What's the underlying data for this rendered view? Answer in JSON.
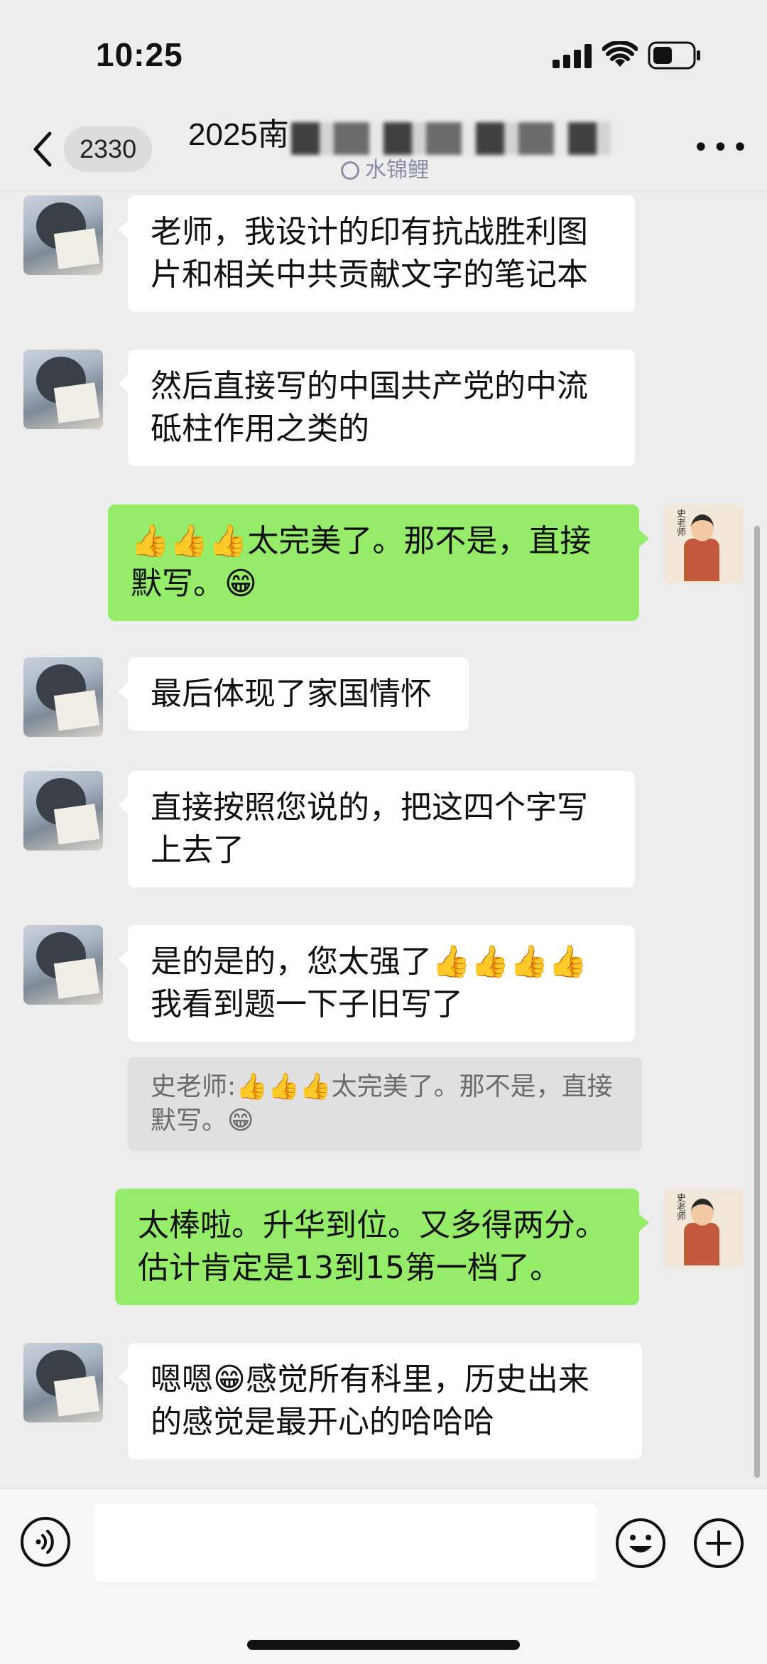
{
  "status_bar": {
    "time": "10:25"
  },
  "nav": {
    "back_count": "2330",
    "title": "2025南",
    "subtitle": "水锦鲤",
    "more_icon": "more-dots-icon"
  },
  "messages": [
    {
      "side": "left",
      "sender": "student",
      "text": "老师，我设计的印有抗战胜利图片和相关中共贡献文字的笔记本"
    },
    {
      "side": "left",
      "sender": "student",
      "text": "然后直接写的中国共产党的中流砥柱作用之类的"
    },
    {
      "side": "right",
      "sender": "teacher",
      "text": "👍👍👍太完美了。那不是，直接默写。😁"
    },
    {
      "side": "left",
      "sender": "student",
      "text": "最后体现了家国情怀"
    },
    {
      "side": "left",
      "sender": "student",
      "text": "直接按照您说的，把这四个字写上去了"
    },
    {
      "side": "left",
      "sender": "student",
      "text": "是的是的，您太强了👍👍👍👍我看到题一下子旧写了",
      "quote": "史老师:👍👍👍太完美了。那不是，直接默写。😁"
    },
    {
      "side": "right",
      "sender": "teacher",
      "text": "太棒啦。升华到位。又多得两分。估计肯定是13到15第一档了。"
    },
    {
      "side": "left",
      "sender": "student",
      "text": "嗯嗯😁感觉所有科里，历史出来的感觉是最开心的哈哈哈"
    }
  ],
  "teacher_avatar_label": "史老师",
  "input_bar": {
    "voice_icon": "voice-icon",
    "emoji_icon": "emoji-icon",
    "plus_icon": "plus-icon"
  },
  "colors": {
    "background": "#ededed",
    "own_bubble": "#95ec69",
    "other_bubble": "#ffffff",
    "quote_bg": "#e0e0e0"
  }
}
